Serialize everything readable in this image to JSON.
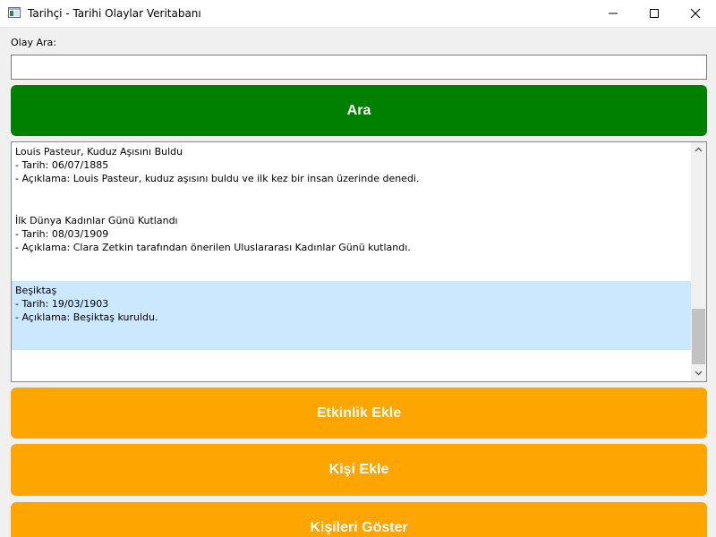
{
  "window": {
    "title": "Tarihçi - Tarihi Olaylar Veritabanı",
    "icon": "app-window-icon"
  },
  "search": {
    "label": "Olay Ara:",
    "value": "",
    "placeholder": "",
    "button_label": "Ara"
  },
  "events": [
    {
      "title": "Louis Pasteur, Kuduz Aşısını Buldu",
      "date": "- Tarih: 06/07/1885",
      "description": "- Açıklama: Louis Pasteur, kuduz aşısını buldu ve ilk kez bir insan üzerinde denedi.",
      "selected": false
    },
    {
      "title": "İlk Dünya Kadınlar Günü Kutlandı",
      "date": "- Tarih: 08/03/1909",
      "description": "- Açıklama: Clara Zetkin tarafından önerilen Uluslararası Kadınlar Günü kutlandı.",
      "selected": false
    },
    {
      "title": "Beşiktaş",
      "date": "- Tarih: 19/03/1903",
      "description": "- Açıklama: Beşiktaş kuruldu.",
      "selected": true
    }
  ],
  "actions": {
    "add_event_label": "Etkinlik Ekle",
    "add_person_label": "Kişi Ekle",
    "show_people_label": "Kişileri Göster"
  },
  "colors": {
    "search_button": "#008000",
    "action_button": "#ffa500",
    "selection": "#cce8ff",
    "button_text": "#ffffff"
  }
}
